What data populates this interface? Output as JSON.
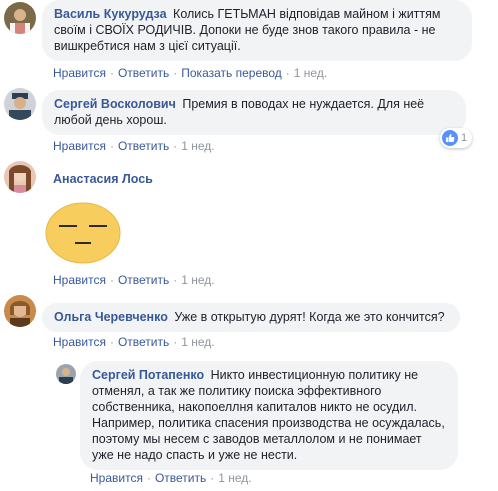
{
  "actions": {
    "like": "Нравится",
    "reply": "Ответить",
    "translate": "Показать перевод",
    "separator": "·"
  },
  "comments": [
    {
      "author": "Василь Кукурудза",
      "text": "Колись ГЕТЬМАН відповідав майном і життям своїм і СВОЇХ РОДИЧІВ. Допоки не буде знов такого правила - не вишкребтися нам з цієї ситуації.",
      "time": "1 нед."
    },
    {
      "author": "Сергей Восколович",
      "text": "Премия в поводах не нуждается. Для неё любой день хорош.",
      "time": "1 нед.",
      "reaction_count": "1",
      "reaction_icon": "like-icon"
    },
    {
      "author": "Анастасия Лось",
      "text": "",
      "sticker_icon": "neutral-face-sticker-icon",
      "time": "1 нед."
    },
    {
      "author": "Ольга Черевченко",
      "text": "Уже в открытую дурят! Когда же это кончится?",
      "time": "1 нед."
    },
    {
      "author": "Сергей Потапенко",
      "text": "Никто инвестиционную политику не отменял, а так же политику поиска эффективного собственника, накопоеллня капиталов никто не осудил. Например, политика спасения производства не осуждалась, поэтому мы несем с заводов металлолом и не понимает уже не надо спасть и уже не нести.",
      "time": "1 нед."
    }
  ],
  "colors": {
    "author_link": "#385898",
    "bubble_bg": "#f2f3f5",
    "meta_text": "#90949c",
    "like_blue": "#5890ff"
  }
}
